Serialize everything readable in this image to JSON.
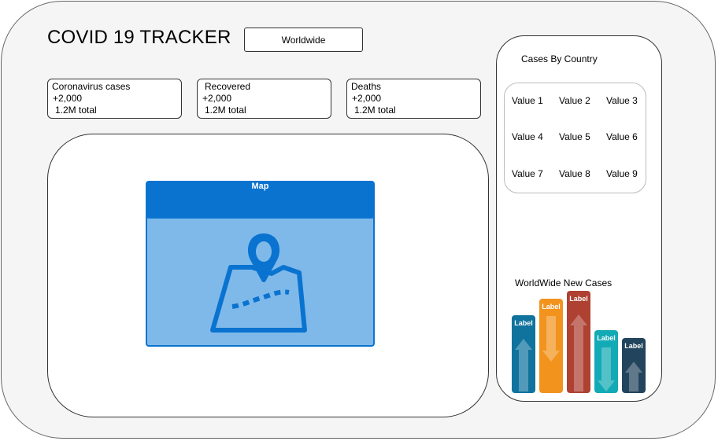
{
  "app": {
    "title": "COVID 19 TRACKER"
  },
  "region_select": {
    "value": "Worldwide"
  },
  "stats": [
    {
      "title": "Coronavirus cases",
      "today": "+2,000",
      "total": "1.2M total"
    },
    {
      "title": "Recovered",
      "today": "+2,000",
      "total": "1.2M total"
    },
    {
      "title": "Deaths",
      "today": "+2,000",
      "total": "1.2M total"
    }
  ],
  "map": {
    "title": "Map",
    "icon": "map-pin-icon"
  },
  "cases_by_country": {
    "title": "Cases By Country",
    "values": [
      "Value 1",
      "Value 2",
      "Value 3",
      "Value 4",
      "Value 5",
      "Value 6",
      "Value 7",
      "Value 8",
      "Value 9"
    ]
  },
  "new_cases_chart": {
    "title": "WorldWide New Cases",
    "bars": [
      {
        "label": "Label",
        "color": "#10739e",
        "arrow": "up"
      },
      {
        "label": "Label",
        "color": "#f2931e",
        "arrow": "down"
      },
      {
        "label": "Label",
        "color": "#ae4132",
        "arrow": "up"
      },
      {
        "label": "Label",
        "color": "#12aab5",
        "arrow": "down"
      },
      {
        "label": "Label",
        "color": "#23445d",
        "arrow": "up"
      }
    ]
  }
}
